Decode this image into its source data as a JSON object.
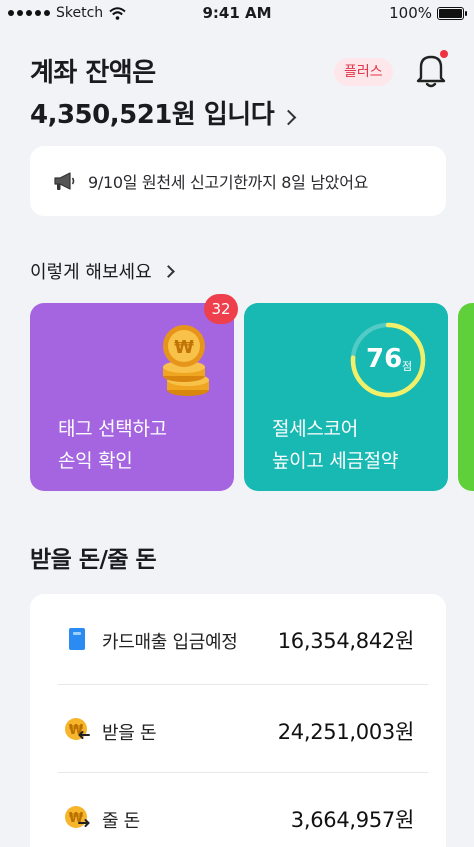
{
  "status_bar": {
    "carrier": "Sketch",
    "time": "9:41 AM",
    "battery": "100%",
    "battery_level": 1.0
  },
  "header": {
    "title_line1": "계좌 잔액은",
    "title_line2": "4,350,521원 입니다",
    "plus_badge": "플러스",
    "accent_color": "#e2364a"
  },
  "notice": {
    "text": "9/10일 원천세 신고기한까지 8일 남았어요"
  },
  "suggestions": {
    "heading": "이렇게 해보세요",
    "cards": [
      {
        "line1": "태그 선택하고",
        "line2": "손익 확인",
        "badge": "32",
        "color": "#a565e0",
        "icon": "coins-icon"
      },
      {
        "line1": "절세스코어",
        "line2": "높이고 세금절약",
        "score": "76",
        "score_unit": "점",
        "score_fraction": 0.76,
        "color": "#18b8b3"
      }
    ]
  },
  "receivables": {
    "heading": "받을 돈/줄 돈",
    "rows": [
      {
        "label": "카드매출 입금예정",
        "value": "16,354,842원",
        "icon": "card-icon"
      },
      {
        "label": "받을 돈",
        "value": "24,251,003원",
        "icon": "won-coin-in-icon"
      },
      {
        "label": "줄 돈",
        "value": "3,664,957원",
        "icon": "won-coin-out-icon"
      }
    ]
  }
}
